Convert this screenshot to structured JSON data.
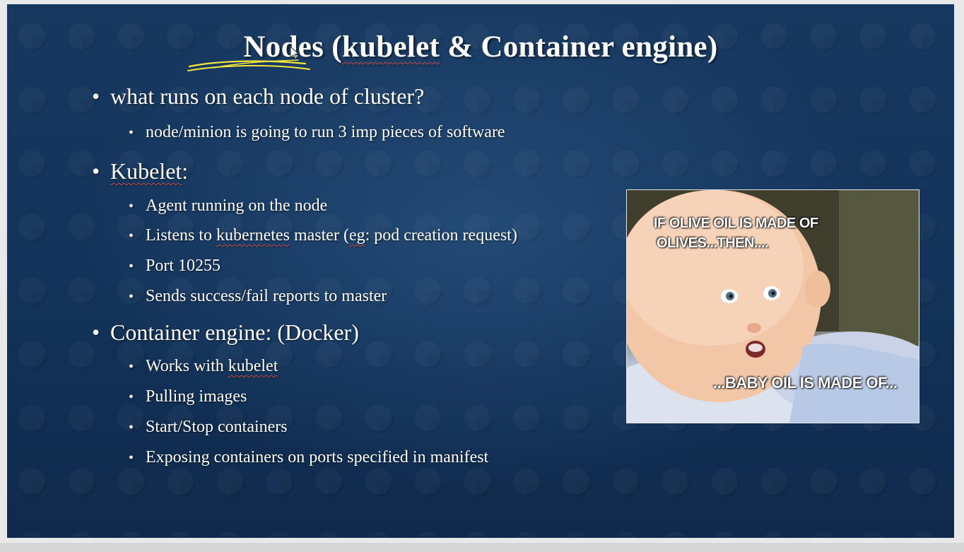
{
  "slide": {
    "title_main": "Nodes",
    "title_open": " (",
    "title_kubelet": "kubelet",
    "title_rest": " & Container engine)",
    "bullets": [
      {
        "level": 1,
        "text": "what runs on each node of cluster?"
      },
      {
        "level": 2,
        "text": "node/minion is going to run 3 imp pieces of software"
      },
      {
        "level": 1,
        "text": "Kubelet",
        "suffix": ":"
      },
      {
        "level": 2,
        "text": "Agent running on the node"
      },
      {
        "level": 2,
        "pre": "Listens to ",
        "word": "kubernetes",
        "mid": " master (",
        "word2": "eg",
        "post": ": pod creation request)"
      },
      {
        "level": 2,
        "text": "Port 10255"
      },
      {
        "level": 2,
        "text": "Sends success/fail reports to master"
      },
      {
        "level": 1,
        "text": "Container engine: (Docker)"
      },
      {
        "level": 2,
        "pre": "Works with ",
        "word": "kubelet"
      },
      {
        "level": 2,
        "text": "Pulling images"
      },
      {
        "level": 2,
        "text": "Start/Stop containers"
      },
      {
        "level": 2,
        "text": "Exposing containers on ports specified in manifest"
      }
    ],
    "bullet_glyph": "•"
  },
  "meme": {
    "top_line1": "IF OLIVE OIL IS MADE OF",
    "top_line2": "OLIVES...THEN....",
    "bottom_line": "...BABY OIL IS MADE OF..."
  },
  "colors": {
    "background": "#13335a",
    "text": "#ffffff",
    "highlight": "#f2e63a",
    "spellcheck": "#c94b4b"
  },
  "icons": {
    "cursor": "pen-cursor-icon"
  }
}
